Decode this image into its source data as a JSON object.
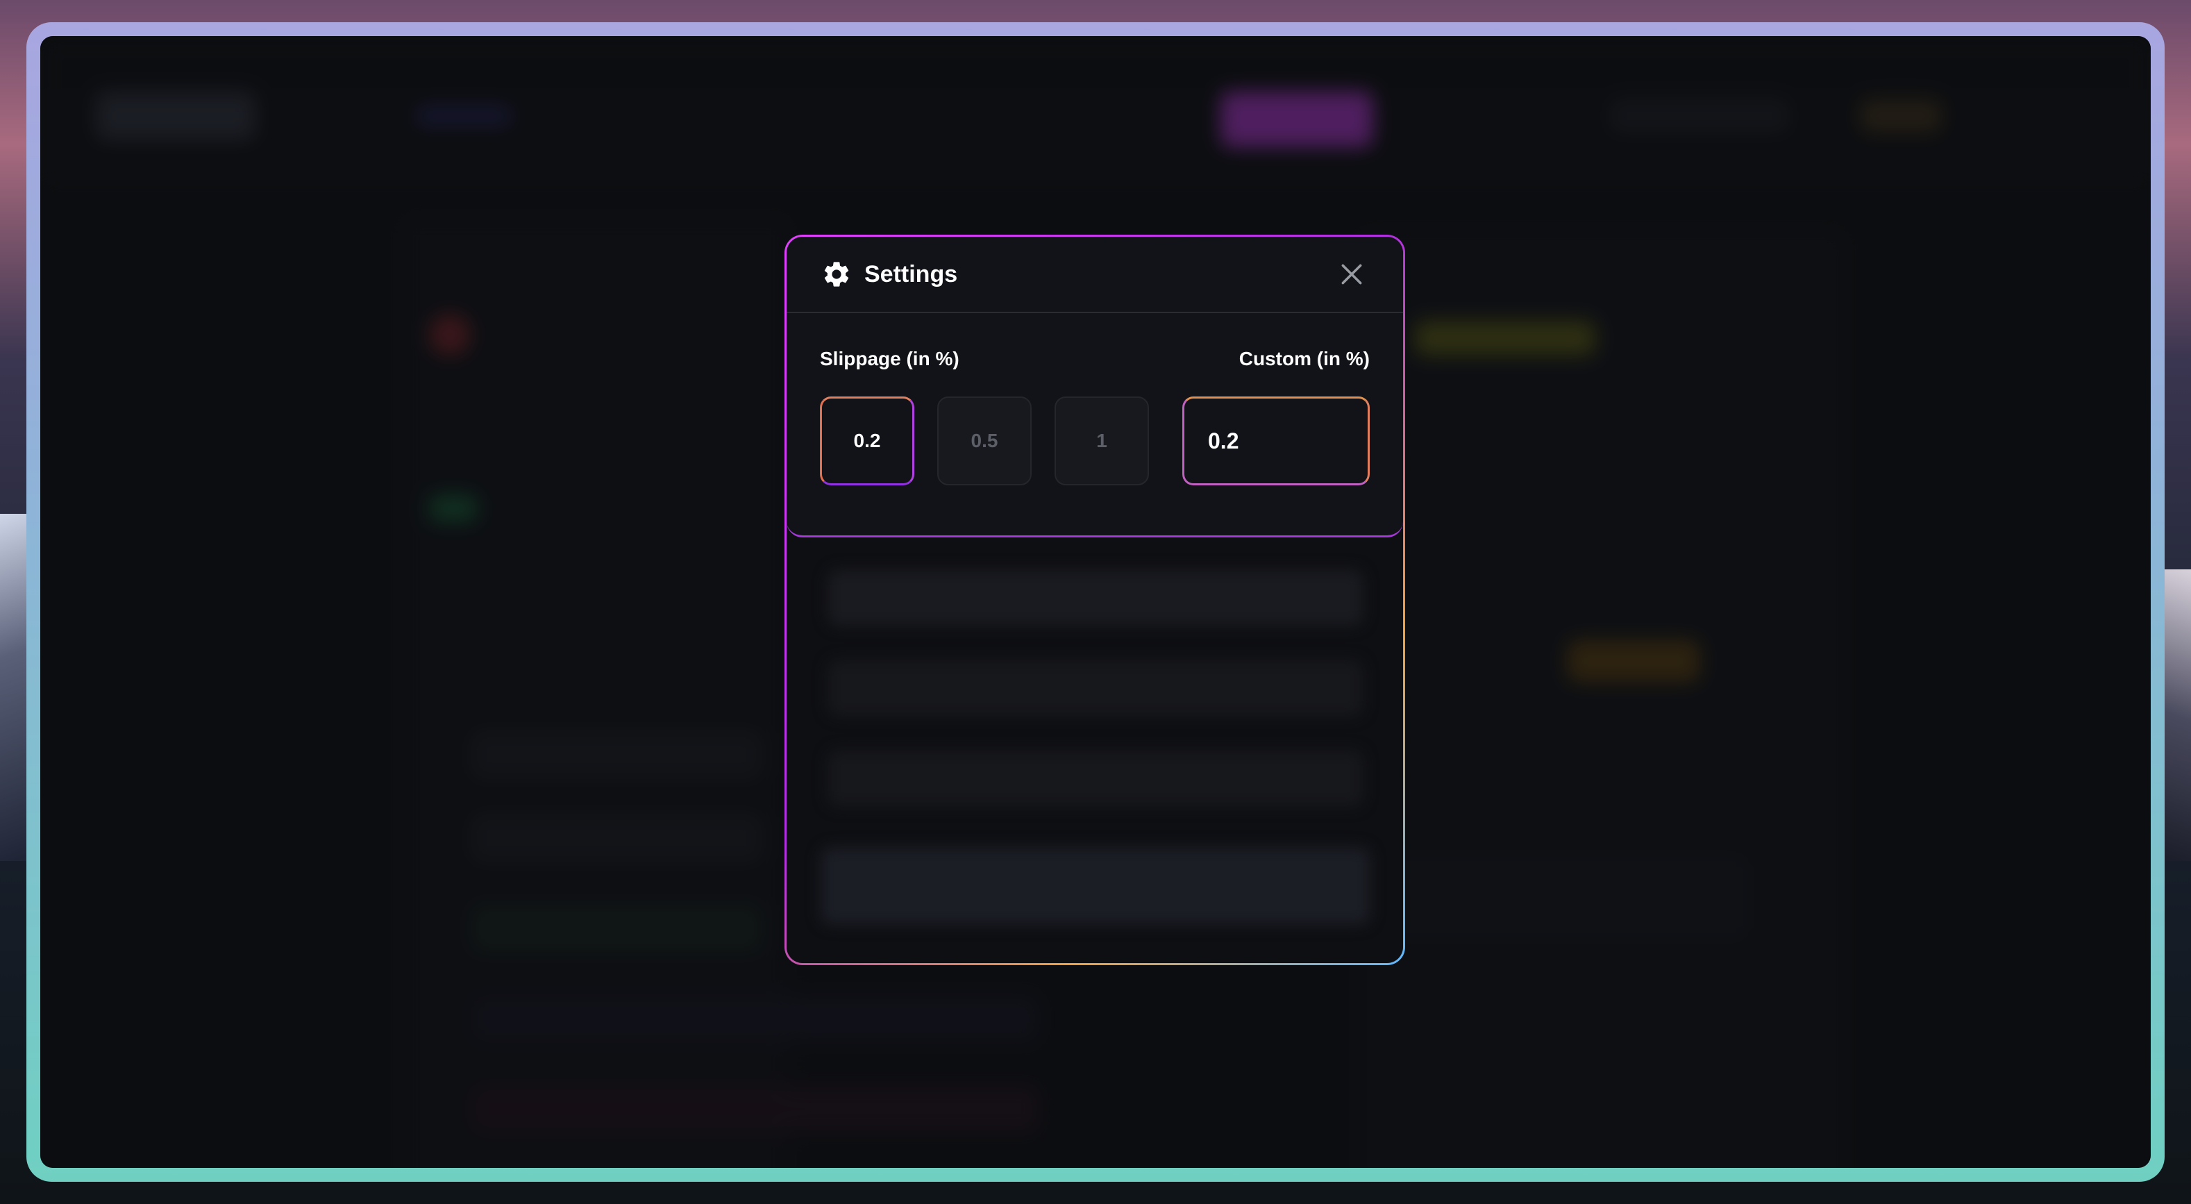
{
  "settings_modal": {
    "title": "Settings",
    "icons": {
      "title_icon": "gear-icon",
      "close_icon": "close-icon"
    },
    "slippage_label": "Slippage (in %)",
    "custom_label": "Custom (in %)",
    "slippage_options": [
      {
        "label": "0.2",
        "selected": true
      },
      {
        "label": "0.5",
        "selected": false
      },
      {
        "label": "1",
        "selected": false
      }
    ],
    "custom_value": "0.2"
  },
  "colors": {
    "accent_pink": "#e040fb",
    "accent_orange": "#f0a040",
    "modal_bg": "#121318"
  }
}
